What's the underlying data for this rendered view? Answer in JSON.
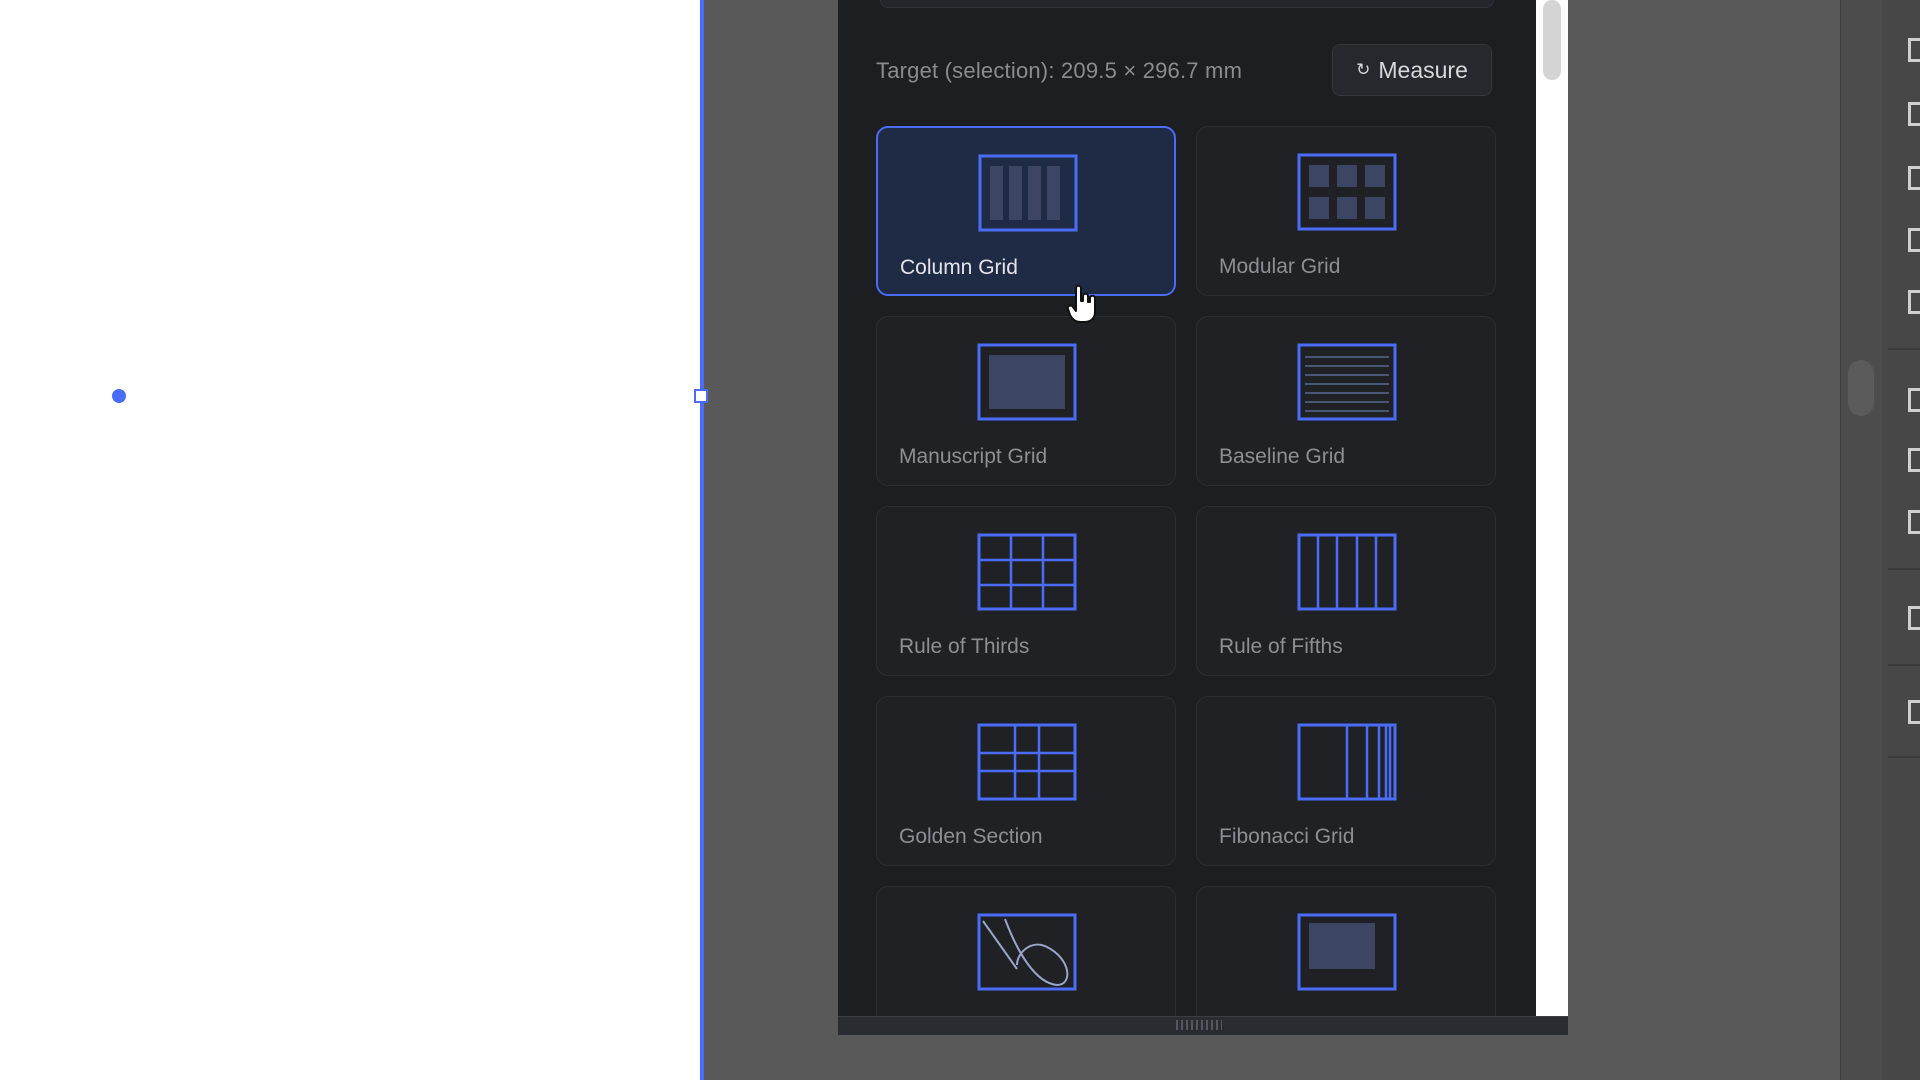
{
  "panel": {
    "target_label": "Target (selection): 209.5 × 296.7 mm",
    "measure_button": {
      "icon": "refresh-icon",
      "glyph": "↻",
      "label": "Measure"
    }
  },
  "grid_presets": [
    {
      "label": "Column Grid",
      "icon": "column-grid-icon",
      "selected": true
    },
    {
      "label": "Modular Grid",
      "icon": "modular-grid-icon",
      "selected": false
    },
    {
      "label": "Manuscript Grid",
      "icon": "manuscript-grid-icon",
      "selected": false
    },
    {
      "label": "Baseline Grid",
      "icon": "baseline-grid-icon",
      "selected": false
    },
    {
      "label": "Rule of Thirds",
      "icon": "rule-of-thirds-icon",
      "selected": false
    },
    {
      "label": "Rule of Fifths",
      "icon": "rule-of-fifths-icon",
      "selected": false
    },
    {
      "label": "Golden Section",
      "icon": "golden-section-icon",
      "selected": false
    },
    {
      "label": "Fibonacci Grid",
      "icon": "fibonacci-grid-icon",
      "selected": false
    },
    {
      "label": "",
      "icon": "golden-spiral-icon",
      "selected": false
    },
    {
      "label": "",
      "icon": "van-de-graaf-icon",
      "selected": false
    }
  ],
  "colors": {
    "accent": "#4a6cf7",
    "panel_bg": "#1d1e22",
    "card_bg": "#1f2125",
    "selected_card_bg": "#1f2a45",
    "label_text": "#8d8f95",
    "workspace_bg": "#595959"
  },
  "cursor": {
    "icon": "hand-pointer-icon"
  }
}
